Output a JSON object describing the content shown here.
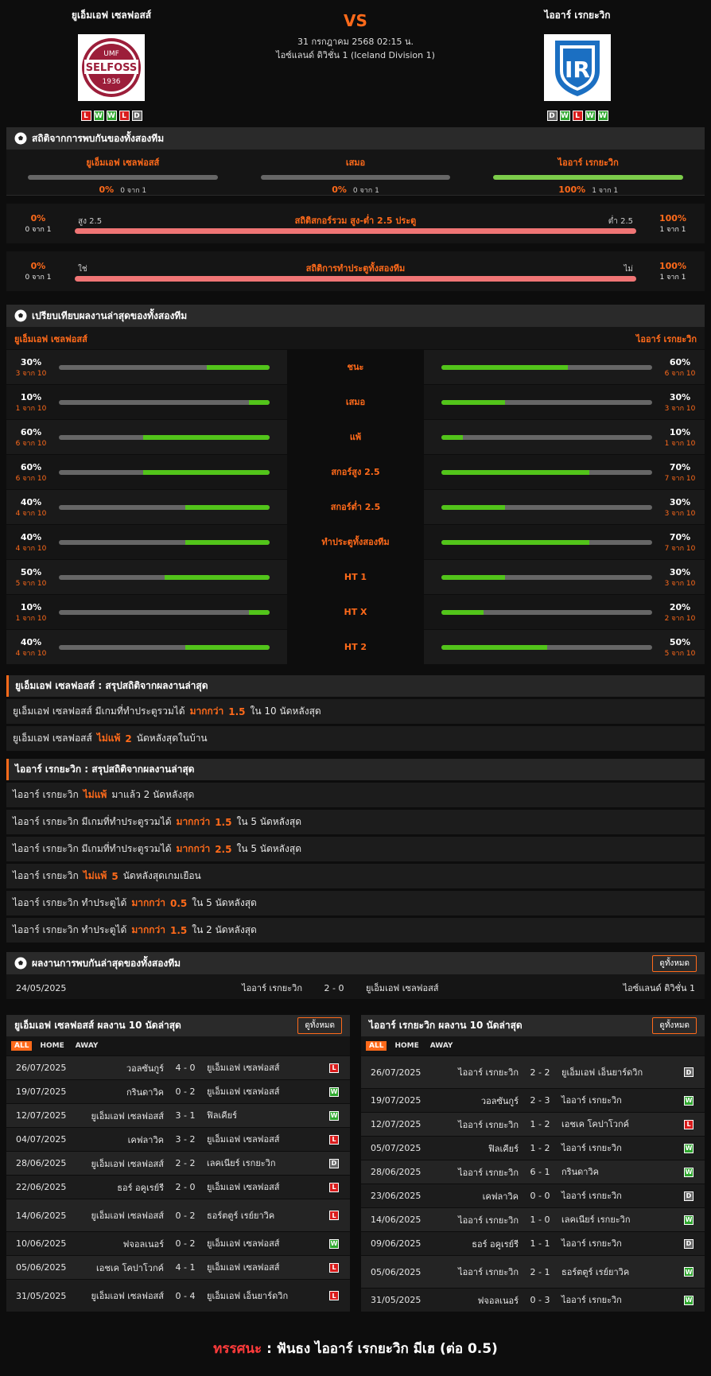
{
  "home": {
    "name": "ยูเอ็มเอฟ เซลฟอสส์",
    "logo_text": "UMF SELFOSS 1936",
    "form": [
      "L",
      "W",
      "W",
      "L",
      "D"
    ]
  },
  "away": {
    "name": "ไออาร์ เรกยะวิก",
    "logo_text": "IR",
    "form": [
      "D",
      "W",
      "L",
      "W",
      "W"
    ]
  },
  "match": {
    "vs": "VS",
    "datetime": "31 กรกฎาคม 2568 02:15 น.",
    "league": "ไอซ์แลนด์ ดิวิชั่น 1 (Iceland Division 1)"
  },
  "h2h": {
    "title": "สถิติจากการพบกันของทั้งสองทีม",
    "cols": [
      {
        "name": "ยูเอ็มเอฟ เซลฟอสส์",
        "pct": "0%",
        "of": "0 จาก 1"
      },
      {
        "name": "เสมอ",
        "pct": "0%",
        "of": "0 จาก 1"
      },
      {
        "name": "ไออาร์ เรกยะวิก",
        "pct": "100%",
        "of": "1 จาก 1"
      }
    ],
    "ou": {
      "title": "สถิติสกอร์รวม สูง-ต่ำ 2.5 ประตู",
      "left_label": "สูง 2.5",
      "right_label": "ต่ำ 2.5",
      "lp": "0%",
      "lof": "0 จาก 1",
      "rp": "100%",
      "rof": "1 จาก 1"
    },
    "btts": {
      "title": "สถิติการทำประตูทั้งสองทีม",
      "left_label": "ใช่",
      "right_label": "ไม่",
      "lp": "0%",
      "lof": "0 จาก 1",
      "rp": "100%",
      "rof": "1 จาก 1"
    }
  },
  "compare": {
    "title": "เปรียบเทียบผลงานล่าสุดของทั้งสองทีม",
    "home": "ยูเอ็มเอฟ เซลฟอสส์",
    "away": "ไออาร์ เรกยะวิก",
    "rows": [
      {
        "label": "ชนะ",
        "hp": "30%",
        "hof": "3 จาก 10",
        "hv": 30,
        "ap": "60%",
        "aof": "6 จาก 10",
        "av": 60
      },
      {
        "label": "เสมอ",
        "hp": "10%",
        "hof": "1 จาก 10",
        "hv": 10,
        "ap": "30%",
        "aof": "3 จาก 10",
        "av": 30
      },
      {
        "label": "แพ้",
        "hp": "60%",
        "hof": "6 จาก 10",
        "hv": 60,
        "ap": "10%",
        "aof": "1 จาก 10",
        "av": 10
      },
      {
        "label": "สกอร์สูง 2.5",
        "hp": "60%",
        "hof": "6 จาก 10",
        "hv": 60,
        "ap": "70%",
        "aof": "7 จาก 10",
        "av": 70
      },
      {
        "label": "สกอร์ต่ำ 2.5",
        "hp": "40%",
        "hof": "4 จาก 10",
        "hv": 40,
        "ap": "30%",
        "aof": "3 จาก 10",
        "av": 30
      },
      {
        "label": "ทำประตูทั้งสองทีม",
        "hp": "40%",
        "hof": "4 จาก 10",
        "hv": 40,
        "ap": "70%",
        "aof": "7 จาก 10",
        "av": 70
      },
      {
        "label": "HT 1",
        "hp": "50%",
        "hof": "5 จาก 10",
        "hv": 50,
        "ap": "30%",
        "aof": "3 จาก 10",
        "av": 30
      },
      {
        "label": "HT X",
        "hp": "10%",
        "hof": "1 จาก 10",
        "hv": 10,
        "ap": "20%",
        "aof": "2 จาก 10",
        "av": 20
      },
      {
        "label": "HT 2",
        "hp": "40%",
        "hof": "4 จาก 10",
        "hv": 40,
        "ap": "50%",
        "aof": "5 จาก 10",
        "av": 50
      }
    ]
  },
  "home_summary": {
    "title": "ยูเอ็มเอฟ เซลฟอสส์ : สรุปสถิติจากผลงานล่าสุด",
    "rows": [
      [
        "ยูเอ็มเอฟ เซลฟอสส์ มีเกมที่ทำประตูรวมได้",
        "มากกว่า",
        "1.5",
        "ใน 10 นัดหลังสุด"
      ],
      [
        "ยูเอ็มเอฟ เซลฟอสส์",
        "ไม่แพ้",
        "2",
        "นัดหลังสุดในบ้าน"
      ]
    ]
  },
  "away_summary": {
    "title": "ไออาร์ เรกยะวิก : สรุปสถิติจากผลงานล่าสุด",
    "rows": [
      [
        "ไออาร์ เรกยะวิก",
        "ไม่แพ้",
        "",
        "มาแล้ว 2 นัดหลังสุด"
      ],
      [
        "ไออาร์ เรกยะวิก มีเกมที่ทำประตูรวมได้",
        "มากกว่า",
        "1.5",
        "ใน 5 นัดหลังสุด"
      ],
      [
        "ไออาร์ เรกยะวิก มีเกมที่ทำประตูรวมได้",
        "มากกว่า",
        "2.5",
        "ใน 5 นัดหลังสุด"
      ],
      [
        "ไออาร์ เรกยะวิก",
        "ไม่แพ้",
        "5",
        "นัดหลังสุดเกมเยือน"
      ],
      [
        "ไออาร์ เรกยะวิก ทำประตูได้",
        "มากกว่า",
        "0.5",
        "ใน 5 นัดหลังสุด"
      ],
      [
        "ไออาร์ เรกยะวิก ทำประตูได้",
        "มากกว่า",
        "1.5",
        "ใน 2 นัดหลังสุด"
      ]
    ]
  },
  "last_h2h": {
    "title": "ผลงานการพบกันล่าสุดของทั้งสองทีม",
    "all": "ดูทั้งหมด",
    "date": "24/05/2025",
    "home": "ไออาร์ เรกยะวิก",
    "score": "2 - 0",
    "away": "ยูเอ็มเอฟ เซลฟอสส์",
    "league": "ไอซ์แลนด์ ดิวิชั่น 1"
  },
  "tabs": [
    "ALL",
    "HOME",
    "AWAY"
  ],
  "home_last10": {
    "title": "ยูเอ็มเอฟ เซลฟอสส์ ผลงาน 10 นัดล่าสุด",
    "all": "ดูทั้งหมด",
    "rows": [
      [
        "26/07/2025",
        "วอลซันกูร์",
        "4 - 0",
        "ยูเอ็มเอฟ เซลฟอสส์",
        "L"
      ],
      [
        "19/07/2025",
        "กรินดาวิค",
        "0 - 2",
        "ยูเอ็มเอฟ เซลฟอสส์",
        "W"
      ],
      [
        "12/07/2025",
        "ยูเอ็มเอฟ เซลฟอสส์",
        "3 - 1",
        "ฟิลเคียร์",
        "W"
      ],
      [
        "04/07/2025",
        "เคฟลาวิค",
        "3 - 2",
        "ยูเอ็มเอฟ เซลฟอสส์",
        "L"
      ],
      [
        "28/06/2025",
        "ยูเอ็มเอฟ เซลฟอสส์",
        "2 - 2",
        "เลคเนียร์ เรกยะวิก",
        "D"
      ],
      [
        "22/06/2025",
        "ธอร์ อคูเรย์รี",
        "2 - 0",
        "ยูเอ็มเอฟ เซลฟอสส์",
        "L"
      ],
      [
        "14/06/2025",
        "ยูเอ็มเอฟ เซลฟอสส์",
        "0 - 2",
        "ธอร์ตตูร์ เรย์ยาวิค",
        "L"
      ],
      [
        "10/06/2025",
        "ฟจอลเนอร์",
        "0 - 2",
        "ยูเอ็มเอฟ เซลฟอสส์",
        "W"
      ],
      [
        "05/06/2025",
        "เอชเค โคปาโวกค์",
        "4 - 1",
        "ยูเอ็มเอฟ เซลฟอสส์",
        "L"
      ],
      [
        "31/05/2025",
        "ยูเอ็มเอฟ เซลฟอสส์",
        "0 - 4",
        "ยูเอ็มเอฟ เอ็นยาร์ดวิก",
        "L"
      ]
    ]
  },
  "away_last10": {
    "title": "ไออาร์ เรกยะวิก ผลงาน 10 นัดล่าสุด",
    "all": "ดูทั้งหมด",
    "rows": [
      [
        "26/07/2025",
        "ไออาร์ เรกยะวิก",
        "2 - 2",
        "ยูเอ็มเอฟ เอ็นยาร์ดวิก",
        "D"
      ],
      [
        "19/07/2025",
        "วอลซันกูร์",
        "2 - 3",
        "ไออาร์ เรกยะวิก",
        "W"
      ],
      [
        "12/07/2025",
        "ไออาร์ เรกยะวิก",
        "1 - 2",
        "เอชเค โคปาโวกค์",
        "L"
      ],
      [
        "05/07/2025",
        "ฟิลเคียร์",
        "1 - 2",
        "ไออาร์ เรกยะวิก",
        "W"
      ],
      [
        "28/06/2025",
        "ไออาร์ เรกยะวิก",
        "6 - 1",
        "กรินดาวิค",
        "W"
      ],
      [
        "23/06/2025",
        "เคฟลาวิค",
        "0 - 0",
        "ไออาร์ เรกยะวิก",
        "D"
      ],
      [
        "14/06/2025",
        "ไออาร์ เรกยะวิก",
        "1 - 0",
        "เลคเนียร์ เรกยะวิก",
        "W"
      ],
      [
        "09/06/2025",
        "ธอร์ อคูเรย์รี",
        "1 - 1",
        "ไออาร์ เรกยะวิก",
        "D"
      ],
      [
        "05/06/2025",
        "ไออาร์ เรกยะวิก",
        "2 - 1",
        "ธอร์ตตูร์ เรย์ยาวิค",
        "W"
      ],
      [
        "31/05/2025",
        "ฟจอลเนอร์",
        "0 - 3",
        "ไออาร์ เรกยะวิก",
        "W"
      ]
    ]
  },
  "prediction": {
    "label": "ทรรศนะ",
    "sep": " : ",
    "text": "ฟันธง ไออาร์ เรกยะวิก มีเฮ (ต่อ 0.5)"
  },
  "colors": {
    "accent": "#ff6a1a",
    "win": "#2fa82f",
    "loss": "#d91c1c",
    "draw": "#666666"
  }
}
